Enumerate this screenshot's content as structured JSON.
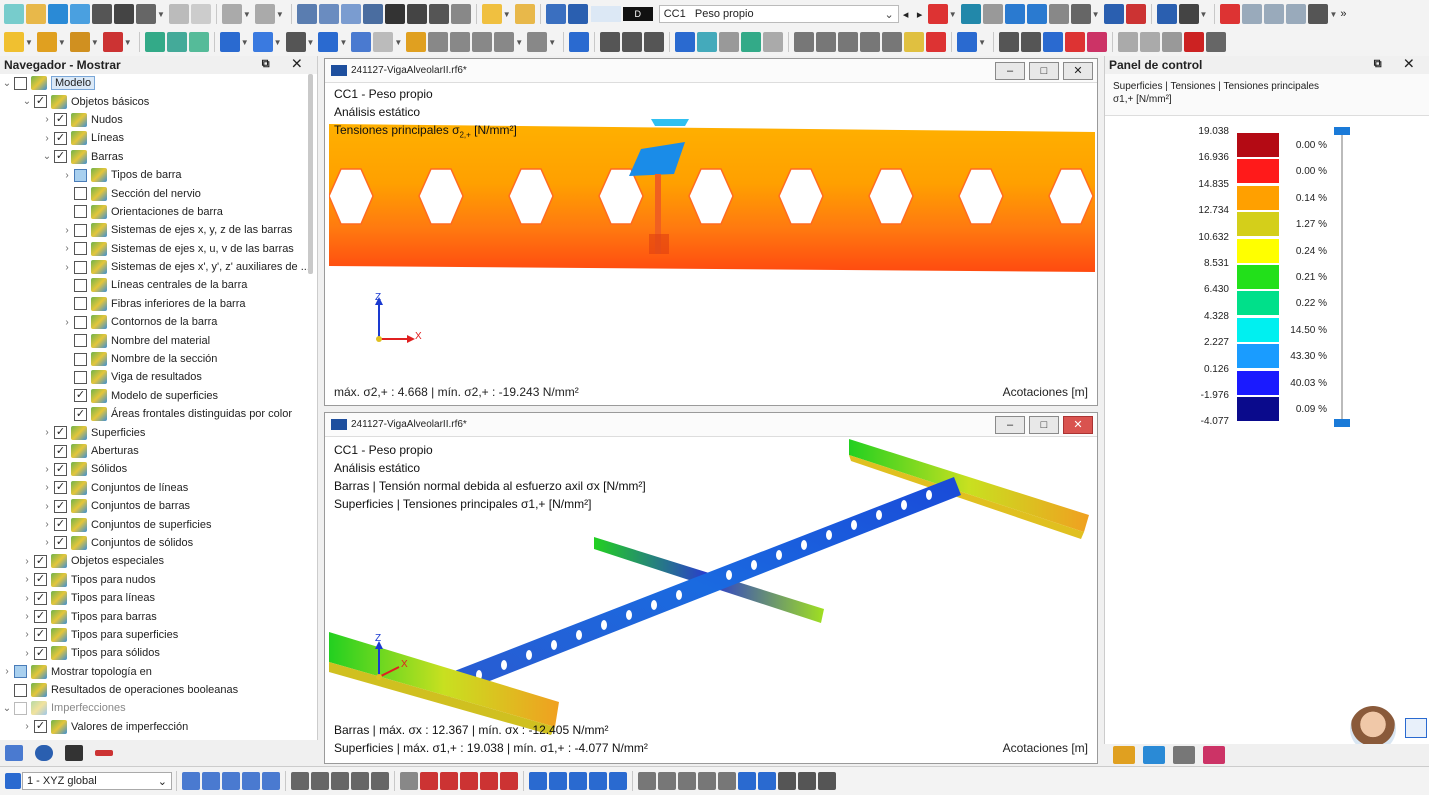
{
  "toolbar": {
    "load_case_tag": "D",
    "load_case_code": "CC1",
    "load_case_name": "Peso propio",
    "expand": "»"
  },
  "navigator": {
    "title": "Navegador - Mostrar",
    "buttons": "⧉ ✕",
    "items": [
      {
        "label": "Modelo",
        "level": 0,
        "arrow": "v",
        "check": "",
        "selected": true
      },
      {
        "label": "Objetos básicos",
        "level": 1,
        "arrow": "v",
        "check": "✓"
      },
      {
        "label": "Nudos",
        "level": 2,
        "arrow": ">",
        "check": "✓"
      },
      {
        "label": "Líneas",
        "level": 2,
        "arrow": ">",
        "check": "✓"
      },
      {
        "label": "Barras",
        "level": 2,
        "arrow": "v",
        "check": "✓"
      },
      {
        "label": "Tipos de barra",
        "level": 3,
        "arrow": ">",
        "check": "",
        "part": true
      },
      {
        "label": "Sección del nervio",
        "level": 3,
        "arrow": "",
        "check": ""
      },
      {
        "label": "Orientaciones de barra",
        "level": 3,
        "arrow": "",
        "check": ""
      },
      {
        "label": "Sistemas de ejes x, y, z de las barras",
        "level": 3,
        "arrow": ">",
        "check": ""
      },
      {
        "label": "Sistemas de ejes x, u, v de las barras",
        "level": 3,
        "arrow": ">",
        "check": ""
      },
      {
        "label": "Sistemas de ejes x', y', z' auxiliares de ...",
        "level": 3,
        "arrow": ">",
        "check": ""
      },
      {
        "label": "Líneas centrales de la barra",
        "level": 3,
        "arrow": "",
        "check": ""
      },
      {
        "label": "Fibras inferiores de la barra",
        "level": 3,
        "arrow": "",
        "check": ""
      },
      {
        "label": "Contornos de la barra",
        "level": 3,
        "arrow": ">",
        "check": ""
      },
      {
        "label": "Nombre del material",
        "level": 3,
        "arrow": "",
        "check": ""
      },
      {
        "label": "Nombre de la sección",
        "level": 3,
        "arrow": "",
        "check": ""
      },
      {
        "label": "Viga de resultados",
        "level": 3,
        "arrow": "",
        "check": ""
      },
      {
        "label": "Modelo de superficies",
        "level": 3,
        "arrow": "",
        "check": "✓"
      },
      {
        "label": "Áreas frontales distinguidas por color",
        "level": 3,
        "arrow": "",
        "check": "✓"
      },
      {
        "label": "Superficies",
        "level": 2,
        "arrow": ">",
        "check": "✓"
      },
      {
        "label": "Aberturas",
        "level": 2,
        "arrow": "",
        "check": "✓"
      },
      {
        "label": "Sólidos",
        "level": 2,
        "arrow": ">",
        "check": "✓"
      },
      {
        "label": "Conjuntos de líneas",
        "level": 2,
        "arrow": ">",
        "check": "✓"
      },
      {
        "label": "Conjuntos de barras",
        "level": 2,
        "arrow": ">",
        "check": "✓"
      },
      {
        "label": "Conjuntos de superficies",
        "level": 2,
        "arrow": ">",
        "check": "✓"
      },
      {
        "label": "Conjuntos de sólidos",
        "level": 2,
        "arrow": ">",
        "check": "✓"
      },
      {
        "label": "Objetos especiales",
        "level": 1,
        "arrow": ">",
        "check": "✓"
      },
      {
        "label": "Tipos para nudos",
        "level": 1,
        "arrow": ">",
        "check": "✓"
      },
      {
        "label": "Tipos para líneas",
        "level": 1,
        "arrow": ">",
        "check": "✓"
      },
      {
        "label": "Tipos para barras",
        "level": 1,
        "arrow": ">",
        "check": "✓"
      },
      {
        "label": "Tipos para superficies",
        "level": 1,
        "arrow": ">",
        "check": "✓"
      },
      {
        "label": "Tipos para sólidos",
        "level": 1,
        "arrow": ">",
        "check": "✓"
      },
      {
        "label": "Mostrar topología en",
        "level": 0,
        "arrow": ">",
        "check": "",
        "part": true
      },
      {
        "label": "Resultados de operaciones booleanas",
        "level": 0,
        "arrow": "",
        "check": ""
      },
      {
        "label": "Imperfecciones",
        "level": 0,
        "arrow": "v",
        "check": "",
        "grey": true
      },
      {
        "label": "Valores de imperfección",
        "level": 1,
        "arrow": ">",
        "check": "✓"
      }
    ]
  },
  "view1": {
    "title": "241127-VigaAlveolarII.rf6*",
    "line1": "CC1 - Peso propio",
    "line2": "Análisis estático",
    "line3": "Tensiones principales σ",
    "line3_sub": "2,+",
    "line3_unit": " [N/mm²]",
    "footer_left": "máx. σ2,+ : 4.668 | mín. σ2,+ : -19.243 N/mm²",
    "footer_right": "Acotaciones [m]",
    "axis_z": "Z",
    "axis_x": "X"
  },
  "view2": {
    "title": "241127-VigaAlveolarII.rf6*",
    "line1": "CC1 - Peso propio",
    "line2": "Análisis estático",
    "line3": "Barras | Tensión normal debida al esfuerzo axil σx [N/mm²]",
    "line4": "Superficies | Tensiones principales σ1,+ [N/mm²]",
    "footer1": "Barras | máx. σx : 12.367 | mín. σx : -12.405 N/mm²",
    "footer2": "Superficies | máx. σ1,+ : 19.038 | mín. σ1,+ : -4.077 N/mm²",
    "footer_right": "Acotaciones [m]",
    "axis_z": "Z",
    "axis_x": "X"
  },
  "control_panel": {
    "title": "Panel de control",
    "buttons": "⧉ ✕",
    "subtitle": "Superficies | Tensiones | Tensiones principales",
    "unit": "σ1,+ [N/mm²]",
    "values": [
      "19.038",
      "16.936",
      "14.835",
      "12.734",
      "10.632",
      "8.531",
      "6.430",
      "4.328",
      "2.227",
      "0.126",
      "-1.976",
      "-4.077"
    ],
    "bands": [
      {
        "color": "#b40a14",
        "pct": "0.00 %"
      },
      {
        "color": "#ff1a1a",
        "pct": "0.00 %"
      },
      {
        "color": "#ffa000",
        "pct": "0.14 %"
      },
      {
        "color": "#d4cf1a",
        "pct": "1.27 %"
      },
      {
        "color": "#ffff00",
        "pct": "0.24 %"
      },
      {
        "color": "#22e01a",
        "pct": "0.21 %"
      },
      {
        "color": "#00e08a",
        "pct": "0.22 %"
      },
      {
        "color": "#00f0f0",
        "pct": "14.50 %"
      },
      {
        "color": "#1a9cff",
        "pct": "43.30 %"
      },
      {
        "color": "#1a1aff",
        "pct": "40.03 %"
      },
      {
        "color": "#0a0a8c",
        "pct": "0.09 %"
      }
    ]
  },
  "statusbar": {
    "cs_label": "1 - XYZ global"
  }
}
